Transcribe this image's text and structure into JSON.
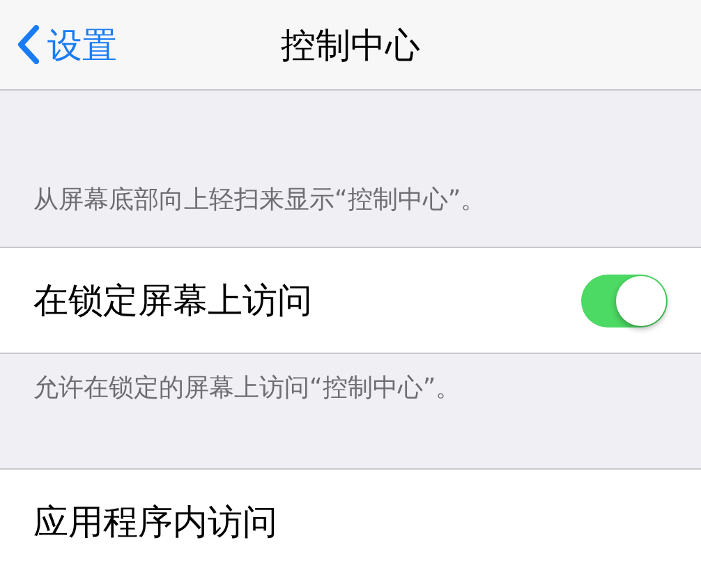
{
  "nav_bar": {
    "back_label": "设置",
    "title": "控制中心"
  },
  "sections": [
    {
      "header": "从屏幕底部向上轻扫来显示“控制中心”。",
      "rows": [
        {
          "kind": "toggle",
          "label": "在锁定屏幕上访问",
          "on": true
        }
      ],
      "footer": "允许在锁定的屏幕上访问“控制中心”。"
    },
    {
      "rows": [
        {
          "kind": "plain",
          "label": "应用程序内访问"
        }
      ]
    }
  ]
}
